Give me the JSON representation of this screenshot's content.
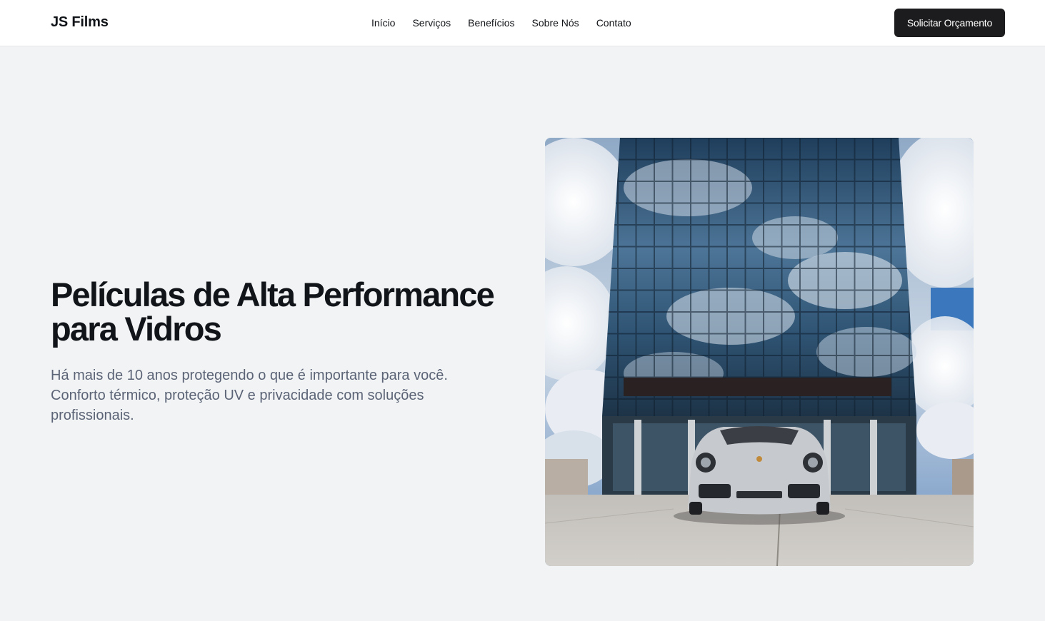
{
  "header": {
    "brand": "JS Films",
    "nav": [
      "Início",
      "Serviços",
      "Benefícios",
      "Sobre Nós",
      "Contato"
    ],
    "cta_label": "Solicitar Orçamento"
  },
  "hero": {
    "title": "Películas de Alta Performance para Vidros",
    "subtitle": "Há mais de 10 anos protegendo o que é importante para você. Conforto térmico, proteção UV e privacidade com soluções profissionais.",
    "image_description_icon": "building-car-photo"
  },
  "colors": {
    "background": "#f2f3f5",
    "cta_bg": "#1c1c1e",
    "text_primary": "#111418",
    "text_muted": "#5b6476"
  }
}
